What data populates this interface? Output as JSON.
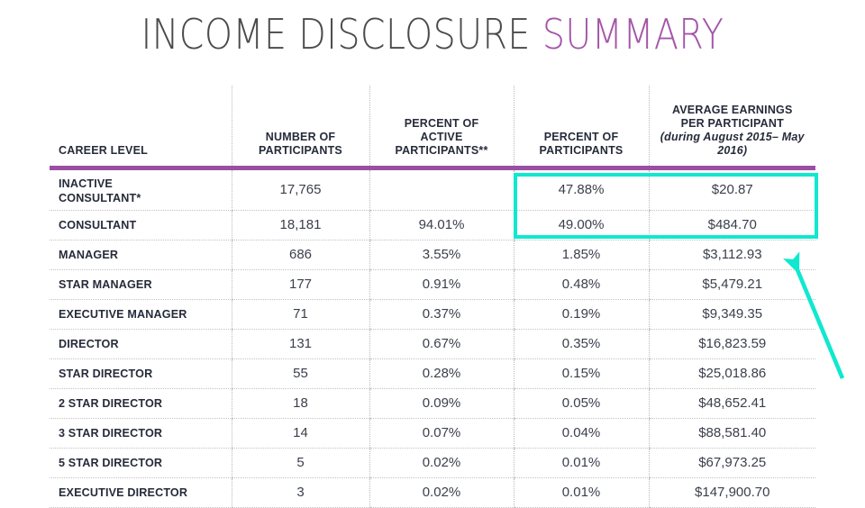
{
  "title": {
    "main": "INCOME DISCLOSURE ",
    "accent": "SUMMARY"
  },
  "colors": {
    "purple_rule": "#9b4fa2",
    "title_accent": "#a455a8",
    "title_main": "#4a4a4a",
    "highlight_teal": "#10e8cf",
    "arrow_teal": "#10e8cf",
    "header_text": "#262b3a",
    "body_text": "#3a3f4b"
  },
  "table": {
    "headers": {
      "career_level": "CAREER LEVEL",
      "number_of_participants": "NUMBER OF\nPARTICIPANTS",
      "number_of_participants_l1": "NUMBER OF",
      "number_of_participants_l2": "PARTICIPANTS",
      "percent_active_l1": "PERCENT OF",
      "percent_active_l2": "ACTIVE",
      "percent_active_l3": "PARTICIPANTS**",
      "percent_of_l1": "PERCENT OF",
      "percent_of_l2": "PARTICIPANTS",
      "avg_earnings_l1": "AVERAGE EARNINGS",
      "avg_earnings_l2": "PER PARTICIPANT",
      "avg_earnings_sub": "(during August 2015– May 2016)"
    },
    "rows": [
      {
        "level_l1": "INACTIVE",
        "level_l2": "CONSULTANT*",
        "number": "17,765",
        "percent_active": "",
        "percent": "47.88%",
        "average_earnings": "$20.87"
      },
      {
        "level_l1": "CONSULTANT",
        "level_l2": "",
        "number": "18,181",
        "percent_active": "94.01%",
        "percent": "49.00%",
        "average_earnings": "$484.70"
      },
      {
        "level_l1": "MANAGER",
        "level_l2": "",
        "number": "686",
        "percent_active": "3.55%",
        "percent": "1.85%",
        "average_earnings": "$3,112.93"
      },
      {
        "level_l1": "STAR MANAGER",
        "level_l2": "",
        "number": "177",
        "percent_active": "0.91%",
        "percent": "0.48%",
        "average_earnings": "$5,479.21"
      },
      {
        "level_l1": "EXECUTIVE MANAGER",
        "level_l2": "",
        "number": "71",
        "percent_active": "0.37%",
        "percent": "0.19%",
        "average_earnings": "$9,349.35"
      },
      {
        "level_l1": "DIRECTOR",
        "level_l2": "",
        "number": "131",
        "percent_active": "0.67%",
        "percent": "0.35%",
        "average_earnings": "$16,823.59"
      },
      {
        "level_l1": "STAR DIRECTOR",
        "level_l2": "",
        "number": "55",
        "percent_active": "0.28%",
        "percent": "0.15%",
        "average_earnings": "$25,018.86"
      },
      {
        "level_l1": "2 STAR DIRECTOR",
        "level_l2": "",
        "number": "18",
        "percent_active": "0.09%",
        "percent": "0.05%",
        "average_earnings": "$48,652.41"
      },
      {
        "level_l1": "3 STAR DIRECTOR",
        "level_l2": "",
        "number": "14",
        "percent_active": "0.07%",
        "percent": "0.04%",
        "average_earnings": "$88,581.40"
      },
      {
        "level_l1": "5 STAR DIRECTOR",
        "level_l2": "",
        "number": "5",
        "percent_active": "0.02%",
        "percent": "0.01%",
        "average_earnings": "$67,973.25"
      },
      {
        "level_l1": "EXECUTIVE DIRECTOR",
        "level_l2": "",
        "number": "3",
        "percent_active": "0.02%",
        "percent": "0.01%",
        "average_earnings": "$147,900.70"
      }
    ]
  },
  "annotations": {
    "highlight_box_label": "teal-highlight-box",
    "arrow_label": "teal-arrow-pointer"
  }
}
